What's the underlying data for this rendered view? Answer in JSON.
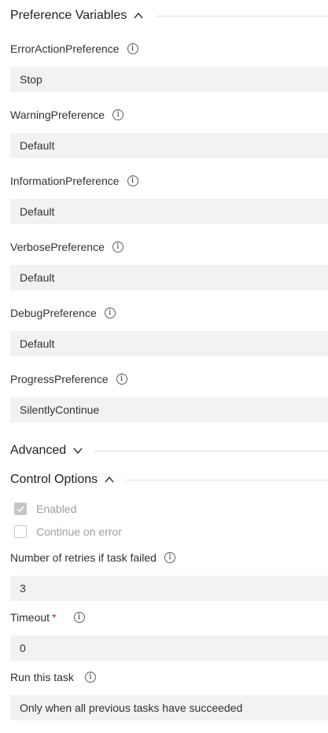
{
  "sections": {
    "preference": {
      "title": "Preference Variables"
    },
    "advanced": {
      "title": "Advanced"
    },
    "control": {
      "title": "Control Options"
    }
  },
  "preferences": [
    {
      "label": "ErrorActionPreference",
      "value": "Stop"
    },
    {
      "label": "WarningPreference",
      "value": "Default"
    },
    {
      "label": "InformationPreference",
      "value": "Default"
    },
    {
      "label": "VerbosePreference",
      "value": "Default"
    },
    {
      "label": "DebugPreference",
      "value": "Default"
    },
    {
      "label": "ProgressPreference",
      "value": "SilentlyContinue"
    }
  ],
  "control": {
    "enabled_label": "Enabled",
    "enabled_checked": true,
    "continue_label": "Continue on error",
    "continue_checked": false,
    "retries_label": "Number of retries if task failed",
    "retries_value": "3",
    "timeout_label": "Timeout",
    "timeout_required": "*",
    "timeout_value": "0",
    "run_label": "Run this task",
    "run_value": "Only when all previous tasks have succeeded"
  },
  "icons": {
    "info": "info-icon",
    "chevron_up": "chevron-up-icon",
    "chevron_down": "chevron-down-icon",
    "check": "checkmark-icon"
  },
  "info_glyph": "i"
}
